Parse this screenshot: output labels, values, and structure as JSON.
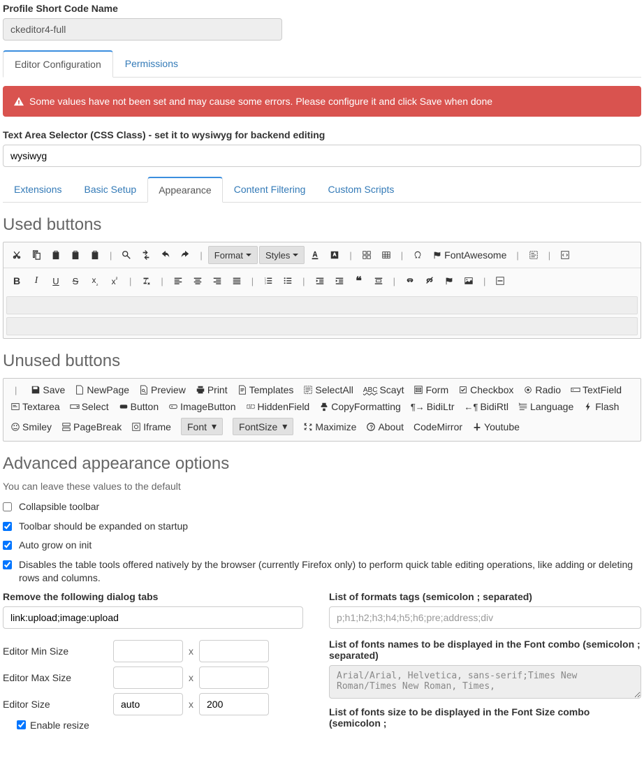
{
  "profile_label": "Profile Short Code Name",
  "profile_value": "ckeditor4-full",
  "main_tabs": {
    "editor_config": "Editor Configuration",
    "permissions": "Permissions"
  },
  "alert": "Some values have not been set and may cause some errors. Please configure it and click Save when done",
  "css_label": "Text Area Selector (CSS Class) - set it to wysiwyg for backend editing",
  "css_value": "wysiwyg",
  "subtabs": {
    "extensions": "Extensions",
    "basic": "Basic Setup",
    "appearance": "Appearance",
    "filtering": "Content Filtering",
    "scripts": "Custom Scripts"
  },
  "used_title": "Used buttons",
  "used_row1_dropdowns": {
    "format": "Format",
    "styles": "Styles"
  },
  "used_row1_labels": {
    "fontawesome": " FontAwesome"
  },
  "unused_title": "Unused buttons",
  "unused": {
    "save": "Save",
    "newpage": "NewPage",
    "preview": "Preview",
    "print": "Print",
    "templates": "Templates",
    "selectall": "SelectAll",
    "scayt": "Scayt",
    "form": "Form",
    "checkbox": "Checkbox",
    "radio": "Radio",
    "textfield": "TextField",
    "textarea": "Textarea",
    "select": "Select",
    "button": "Button",
    "imagebutton": "ImageButton",
    "hiddenfield": "HiddenField",
    "copyformatting": "CopyFormatting",
    "bidiltr": "BidiLtr",
    "bidirtl": "BidiRtl",
    "language": "Language",
    "flash": "Flash",
    "smiley": "Smiley",
    "pagebreak": "PageBreak",
    "iframe": "Iframe",
    "font": "Font",
    "fontsize": "FontSize",
    "maximize": "Maximize",
    "about": "About",
    "codemirror": "CodeMirror",
    "youtube": " Youtube"
  },
  "advanced_title": "Advanced appearance options",
  "advanced_help": "You can leave these values to the default",
  "checks": {
    "collapsible": "Collapsible toolbar",
    "expanded": "Toolbar should be expanded on startup",
    "autogrow": "Auto grow on init",
    "disabletable": "Disables the table tools offered natively by the browser (currently Firefox only) to perform quick table editing operations, like adding or deleting rows and columns."
  },
  "remove_label": "Remove the following dialog tabs",
  "remove_value": "link:upload;image:upload",
  "formats_label": "List of formats tags (semicolon ; separated)",
  "formats_placeholder": "p;h1;h2;h3;h4;h5;h6;pre;address;div",
  "fonts_label": "List of fonts names to be displayed in the Font combo (semicolon ; separated)",
  "fonts_value": "Arial/Arial, Helvetica, sans-serif;Times New Roman/Times New Roman, Times,",
  "fontsize_label": "List of fonts size to be displayed in the Font Size combo (semicolon ;",
  "sizes": {
    "min_label": "Editor Min Size",
    "max_label": "Editor Max Size",
    "size_label": "Editor Size",
    "auto": "auto",
    "h": "200",
    "enable_resize": "Enable resize"
  }
}
